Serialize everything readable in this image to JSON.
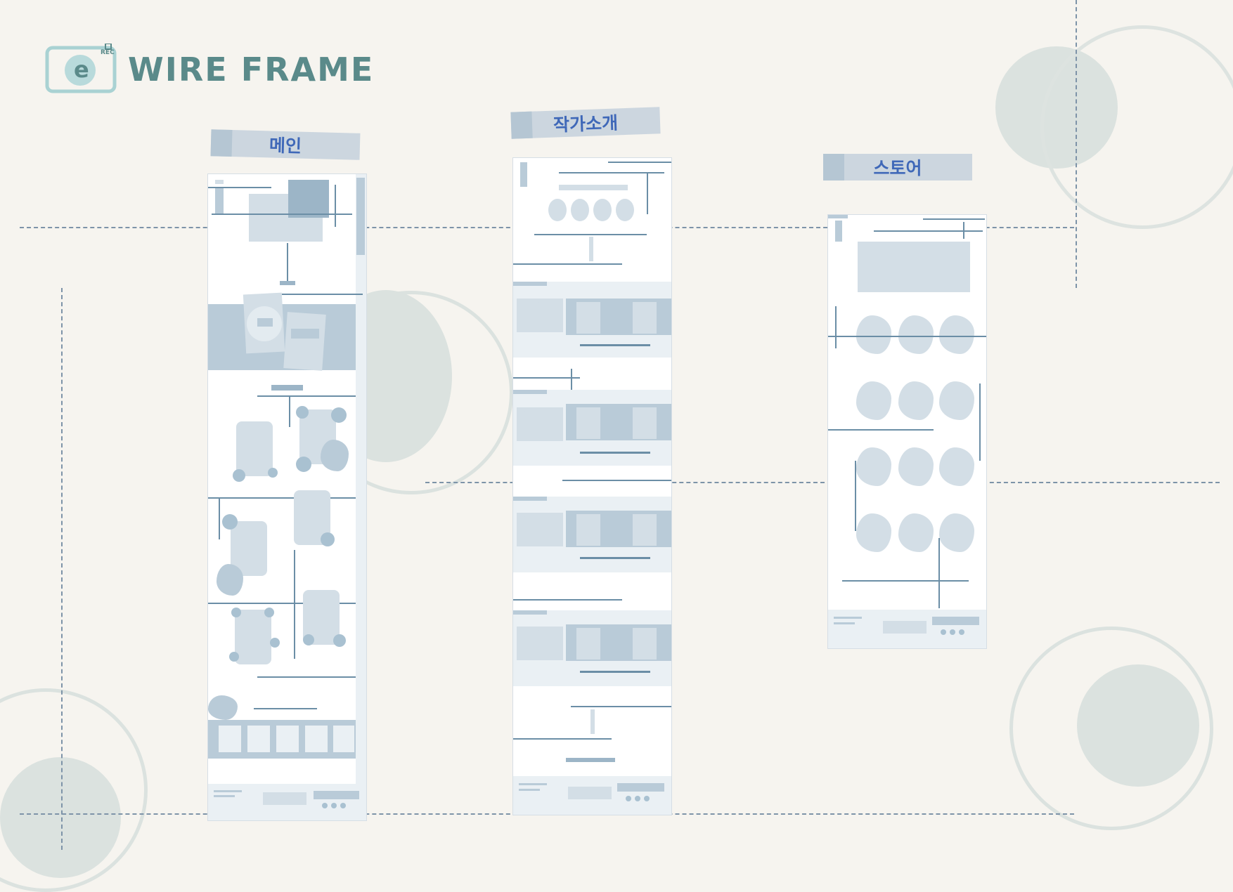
{
  "header": {
    "title": "WIRE FRAME",
    "logo_badge": "REC",
    "logo_letter": "e"
  },
  "sections": [
    {
      "label": "메인"
    },
    {
      "label": "작가소개"
    },
    {
      "label": "스토어"
    }
  ],
  "colors": {
    "background": "#f6f4ef",
    "accent_blue": "#3f68b8",
    "wire_block": "#d3dee6",
    "wire_line": "#6b8ea6",
    "title_teal": "#5a8a8a"
  }
}
